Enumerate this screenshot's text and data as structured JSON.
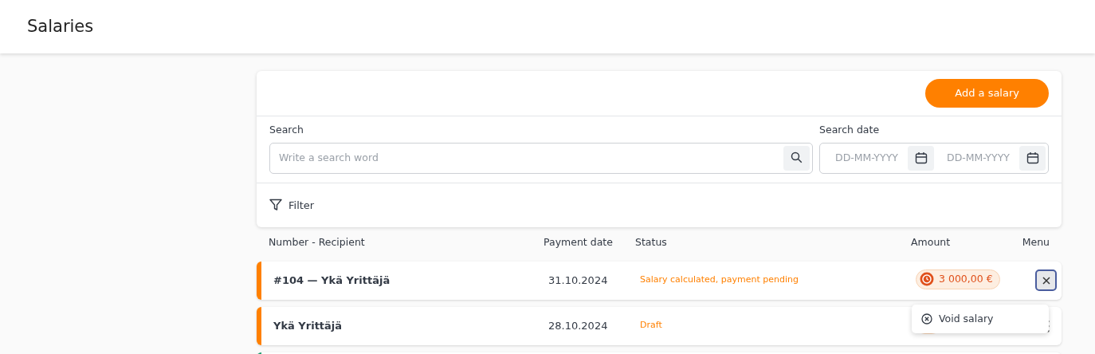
{
  "header": {
    "title": "Salaries"
  },
  "toolbar": {
    "add_button": "Add a salary"
  },
  "search": {
    "label": "Search",
    "placeholder": "Write a search word"
  },
  "date_search": {
    "label": "Search date",
    "from_placeholder": "DD-MM-YYYY",
    "to_placeholder": "DD-MM-YYYY"
  },
  "filter": {
    "label": "Filter"
  },
  "table": {
    "columns": [
      "Number - Recipient",
      "Payment date",
      "Status",
      "Amount",
      "Menu"
    ],
    "rows": [
      {
        "recipient": "#104 — Ykä Yrittäjä",
        "payment_date": "31.10.2024",
        "status": "Salary calculated, payment pending",
        "amount": "3 000,00 €",
        "color": "#ff8000",
        "menu_open": true
      },
      {
        "recipient": "Ykä Yrittäjä",
        "payment_date": "28.10.2024",
        "status": "Draft",
        "color": "#ff8000",
        "menu_open": false
      },
      {
        "color": "#1a9c6e"
      }
    ]
  },
  "menu": {
    "items": [
      "Void salary"
    ]
  }
}
